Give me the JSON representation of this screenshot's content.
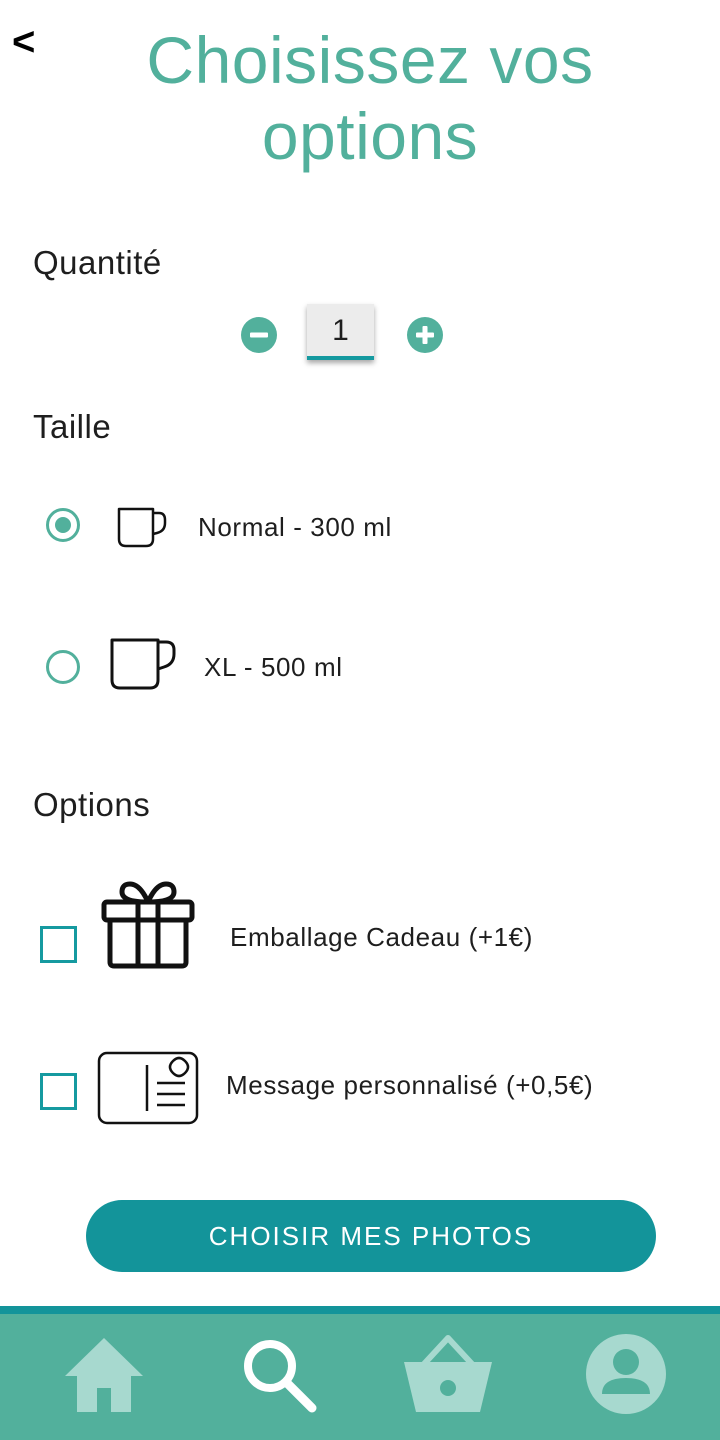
{
  "header": {
    "back_label": "<",
    "title": "Choisissez vos options"
  },
  "quantity": {
    "label": "Quantité",
    "value": "1",
    "decrement_icon": "minus-circle-icon",
    "increment_icon": "plus-circle-icon"
  },
  "size": {
    "label": "Taille",
    "options": [
      {
        "label": "Normal - 300 ml",
        "selected": true,
        "icon": "mug-small-icon"
      },
      {
        "label": "XL - 500 ml",
        "selected": false,
        "icon": "mug-large-icon"
      }
    ]
  },
  "extras": {
    "label": "Options",
    "items": [
      {
        "label": "Emballage Cadeau (+1€)",
        "checked": false,
        "icon": "gift-icon"
      },
      {
        "label": "Message personnalisé (+0,5€)",
        "checked": false,
        "icon": "postcard-icon"
      }
    ]
  },
  "cta": {
    "label": "CHOISIR MES PHOTOS"
  },
  "bottom_nav": {
    "items": [
      {
        "name": "home",
        "icon": "home-icon",
        "active": false
      },
      {
        "name": "search",
        "icon": "search-icon",
        "active": true
      },
      {
        "name": "basket",
        "icon": "basket-icon",
        "active": false
      },
      {
        "name": "profile",
        "icon": "profile-icon",
        "active": false
      }
    ]
  },
  "colors": {
    "accent": "#52b09c",
    "primary": "#13949a",
    "inactive_nav_icon": "#a7d9cf",
    "active_nav_icon": "#ffffff"
  }
}
